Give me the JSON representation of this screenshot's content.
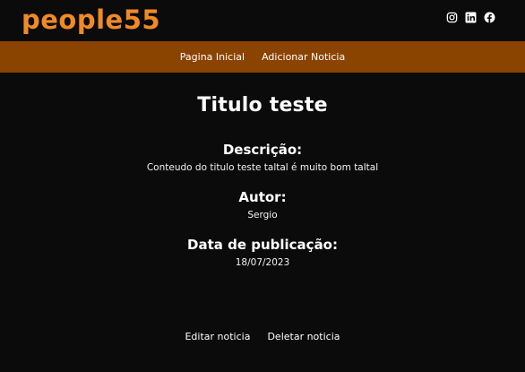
{
  "header": {
    "logo_text": "people55",
    "logo_color": "#f08a24",
    "social_icons": [
      "instagram-icon",
      "linkedin-icon",
      "facebook-icon"
    ]
  },
  "nav": {
    "background": "#8b4300",
    "items": [
      {
        "label": "Pagina Inicial"
      },
      {
        "label": "Adicionar Noticia"
      }
    ]
  },
  "article": {
    "title": "Titulo teste",
    "description_label": "Descrição:",
    "description": "Conteudo do titulo teste taltal é muito bom taltal",
    "author_label": "Autor:",
    "author": "Sergio",
    "date_label": "Data de publicação:",
    "date": "18/07/2023"
  },
  "actions": {
    "edit_label": "Editar noticia",
    "delete_label": "Deletar noticia"
  }
}
